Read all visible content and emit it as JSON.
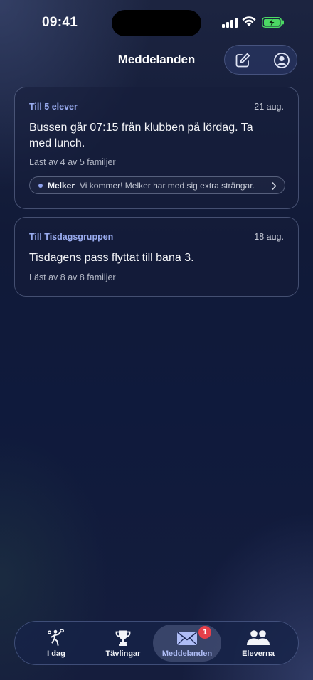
{
  "status_bar": {
    "time": "09:41"
  },
  "nav": {
    "title": "Meddelanden",
    "compose_icon": "compose-icon",
    "profile_icon": "profile-icon"
  },
  "messages": [
    {
      "recipient": "Till 5 elever",
      "date": "21 aug.",
      "body": "Bussen går 07:15 från klubben på lördag. Ta med lunch.",
      "read_status": "Läst av 4 av 5 familjer",
      "reply": {
        "name": "Melker",
        "text": "Vi kommer! Melker har med sig extra strängar."
      }
    },
    {
      "recipient": "Till Tisdagsgruppen",
      "date": "18 aug.",
      "body": "Tisdagens pass flyttat till bana 3.",
      "read_status": "Läst av 8 av 8 familjer"
    }
  ],
  "tabs": [
    {
      "label": "I dag",
      "icon": "tennis-player-icon"
    },
    {
      "label": "Tävlingar",
      "icon": "trophy-icon"
    },
    {
      "label": "Meddelanden",
      "icon": "envelope-icon",
      "badge": "1",
      "active": true
    },
    {
      "label": "Eleverna",
      "icon": "people-icon"
    }
  ],
  "colors": {
    "accent": "#9aacf0",
    "badge": "#e5404a",
    "battery": "#4cd964"
  }
}
